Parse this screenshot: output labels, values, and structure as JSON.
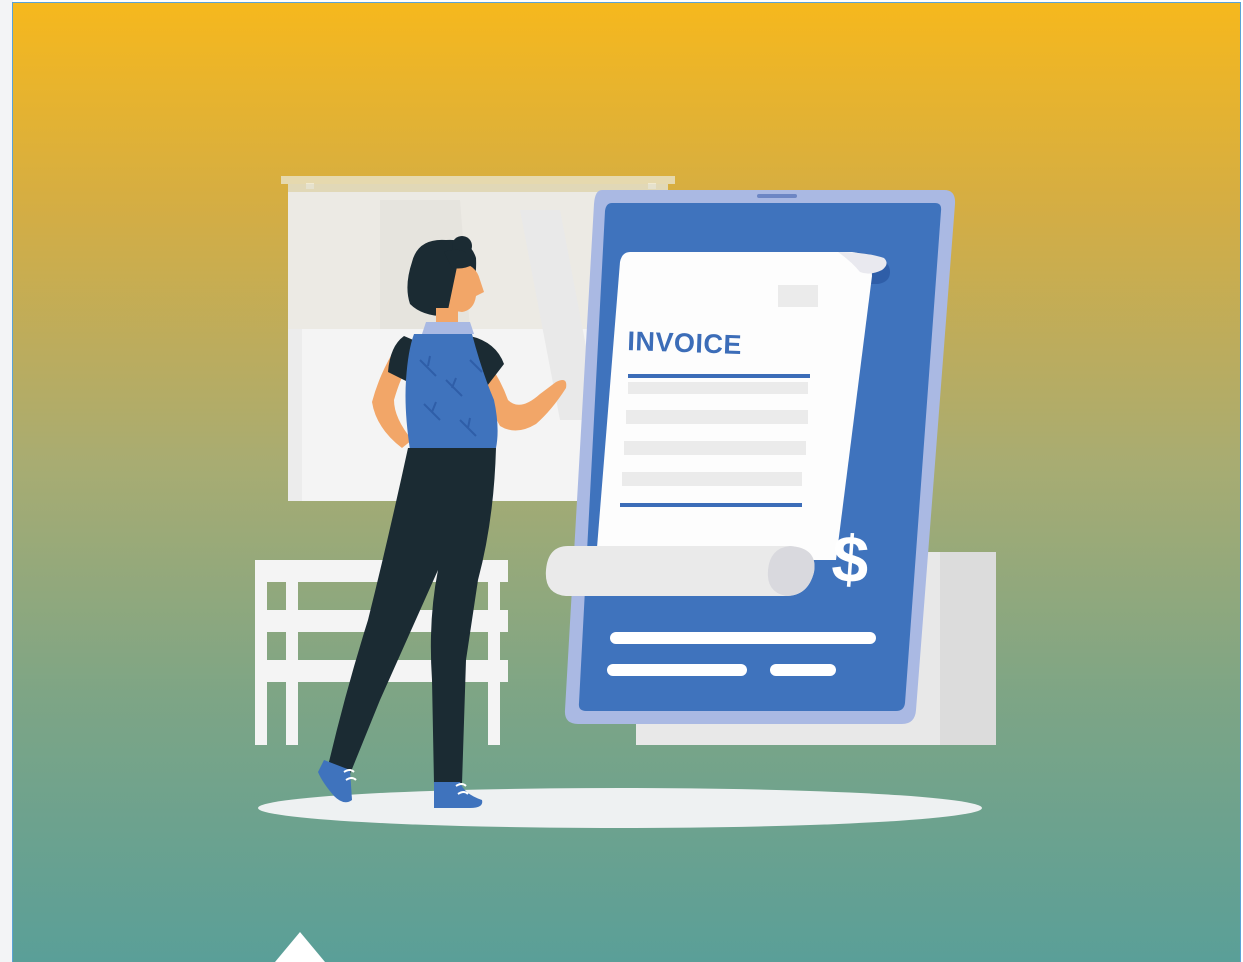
{
  "illustration": {
    "document_heading": "INVOICE",
    "currency_symbol": "$"
  },
  "colors": {
    "gradient_top": "#f6b81d",
    "gradient_bottom": "#5a9f98",
    "tablet_blue": "#3f73bd",
    "tablet_frame": "#a9b9e3",
    "text_blue": "#3c6db8",
    "pants": "#1b2b33",
    "skin": "#f2a668",
    "hair": "#1b2b33"
  },
  "icons": [
    "woman-figure",
    "tablet-device",
    "invoice-scroll",
    "dollar-sign",
    "window-blind",
    "bench",
    "play-triangle"
  ]
}
